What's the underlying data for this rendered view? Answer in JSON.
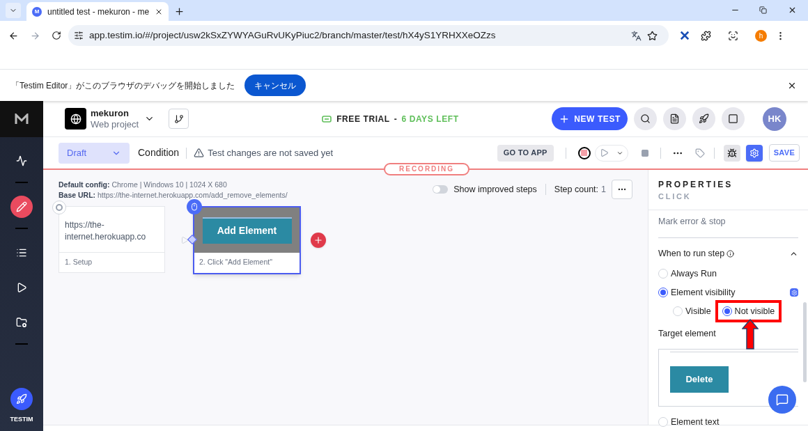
{
  "browser": {
    "favicon_letter": "M",
    "tab_title": "untitled test - mekuron - me",
    "url": "app.testim.io/#/project/usw2kSxZYWYAGuRvUKyPiuc2/branch/master/test/hX4yS1YRHXXeOZzs",
    "profile_letter": "h"
  },
  "infobar": {
    "message": "「Testim Editor」がこのブラウザのデバッグを開始しました",
    "cancel": "キャンセル"
  },
  "sidebar": {
    "items": [
      {
        "kind": "activity",
        "selected": false
      },
      {
        "kind": "edit",
        "selected": true
      },
      {
        "kind": "list",
        "selected": false
      },
      {
        "kind": "play",
        "selected": false
      },
      {
        "kind": "folder",
        "selected": false
      }
    ],
    "footer_label": "TESTIM"
  },
  "header": {
    "project_name": "mekuron",
    "project_type": "Web project",
    "trial": "FREE TRIAL",
    "trial_separator": "-",
    "trial_days": "6 DAYS LEFT",
    "new_test": "NEW TEST",
    "avatar": "HK"
  },
  "toolbar": {
    "status": "Draft",
    "condition": "Condition",
    "warning": "Test changes are not saved yet",
    "go_to_app": "GO TO APP",
    "save": "SAVE"
  },
  "recording": "RECORDING",
  "canvas": {
    "default_config_label": "Default config:",
    "default_config": "Chrome | Windows 10 | 1024 X 680",
    "base_url_label": "Base URL:",
    "base_url": "https://the-internet.herokuapp.com/add_remove_elements/",
    "toggle": {
      "label": "Show improved steps",
      "on": false
    },
    "step_count_label": "Step count:",
    "step_count": "1",
    "steps": [
      {
        "kind": "setup",
        "text": "https://the-internet.herokuapp.co",
        "caption": "1. Setup",
        "selected": false
      },
      {
        "kind": "click",
        "preview": "Add Element",
        "caption": "2. Click \"Add Element\"",
        "selected": true
      }
    ]
  },
  "properties": {
    "title": "PROPERTIES",
    "subtitle": "CLICK",
    "on_error": "Mark error & stop",
    "section": "When to run step",
    "expanded": true,
    "options": [
      {
        "label": "Always Run",
        "selected": false
      },
      {
        "label": "Element visibility",
        "selected": true,
        "children": [
          {
            "label": "Visible",
            "selected": false,
            "highlighted": false
          },
          {
            "label": "Not visible",
            "selected": true,
            "highlighted": true
          }
        ]
      }
    ],
    "target_label": "Target element",
    "target_preview": "Delete",
    "more_options": [
      {
        "label": "Element text",
        "selected": false
      }
    ]
  }
}
